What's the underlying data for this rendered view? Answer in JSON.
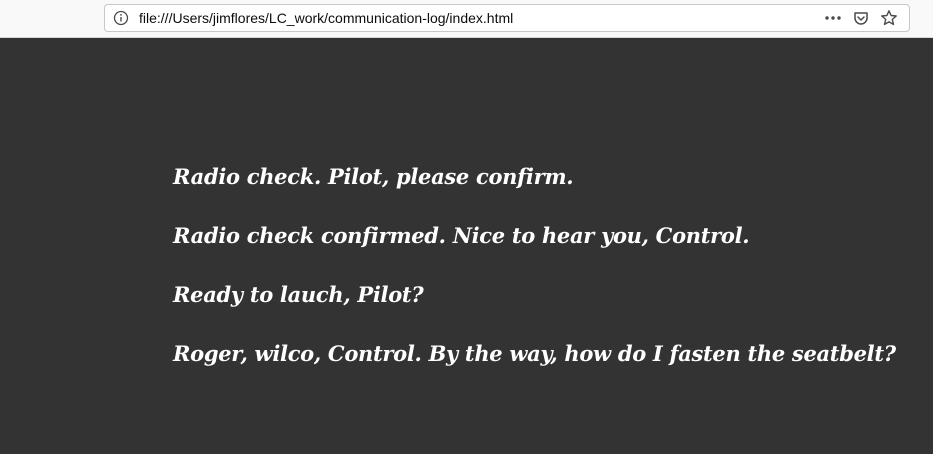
{
  "browser": {
    "url": "file:///Users/jimflores/LC_work/communication-log/index.html",
    "icons": {
      "info": "info-icon",
      "more": "more-actions-icon",
      "pocket": "pocket-icon",
      "bookmark": "bookmark-star-icon"
    }
  },
  "page": {
    "background": "#333333",
    "text_color": "#ffffff",
    "messages": [
      "Radio check. Pilot, please confirm.",
      "Radio check confirmed. Nice to hear you, Control.",
      "Ready to lauch, Pilot?",
      "Roger, wilco, Control. By the way, how do I fasten the seatbelt?"
    ]
  }
}
